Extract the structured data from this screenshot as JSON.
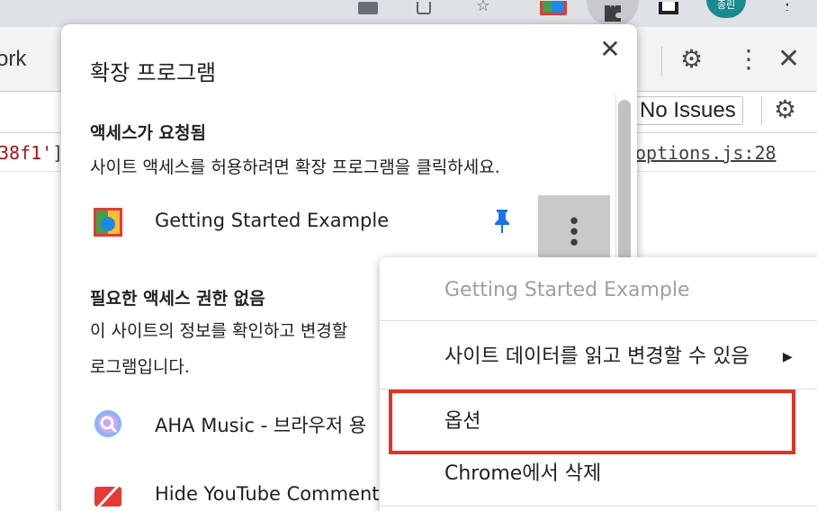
{
  "browser": {
    "profile_label": "종린"
  },
  "devtools": {
    "tab_partial_label": "ork",
    "issues_button": "No Issues",
    "console_left_red": "38f1'",
    "console_left_tail": "]",
    "console_link": "options.js:28"
  },
  "popup": {
    "title": "확장 프로그램",
    "close_symbol": "✕",
    "section1": {
      "heading": "액세스가 요청됨",
      "description": "사이트 액세스를 허용하려면 확장 프로그램을 클릭하세요."
    },
    "extension1": {
      "name": "Getting Started Example"
    },
    "section2": {
      "heading": "필요한 액세스 권한 없음",
      "description_line1": "이 사이트의 정보를 확인하고 변경할",
      "description_line2": "로그램입니다."
    },
    "extension2": {
      "name": "AHA Music - 브라우저 용"
    },
    "extension3": {
      "name": "Hide YouTube Comments"
    }
  },
  "context_menu": {
    "header": "Getting Started Example",
    "items": [
      {
        "label": "사이트 데이터를 읽고 변경할 수 있음"
      },
      {
        "label": "옵션"
      },
      {
        "label": "Chrome에서 삭제"
      }
    ],
    "submenu_arrow": "▶"
  },
  "colors": {
    "highlight_border": "#e53224",
    "pin_icon": "#1a73e8",
    "menu_hover_bg": "#c9c9c9"
  }
}
